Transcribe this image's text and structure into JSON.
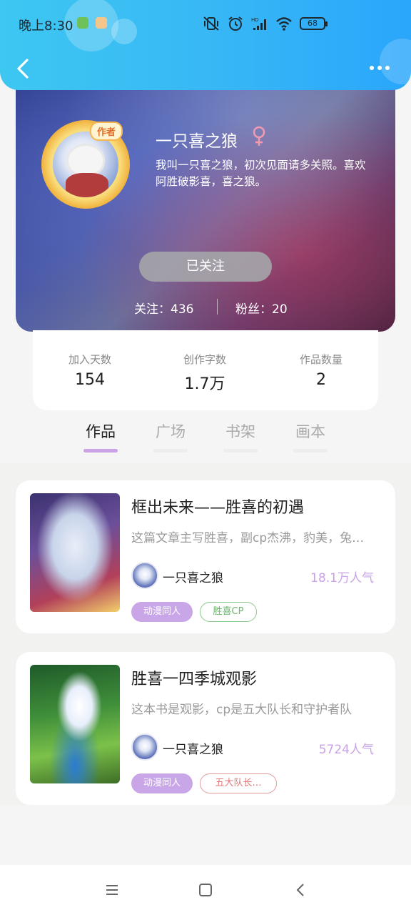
{
  "status_bar": {
    "time": "晚上8:30",
    "battery": "68",
    "icons": [
      "app-icon-green",
      "app-icon-orange",
      "vibrate-off-icon",
      "alarm-icon",
      "signal-hd-icon",
      "wifi-icon"
    ]
  },
  "nav": {
    "back_icon": "back-arrow-icon",
    "more_icon": "more-dots-icon"
  },
  "profile": {
    "author_badge": "作者",
    "username": "一只喜之狼",
    "gender_symbol": "♀",
    "bio": "我叫一只喜之狼，初次见面请多关照。喜欢阿胜破影喜，喜之狼。",
    "follow_button": "已关注",
    "following": "关注：436",
    "fans": "粉丝：20"
  },
  "stats": [
    {
      "label": "加入天数",
      "value": "154"
    },
    {
      "label": "创作字数",
      "value": "1.7万"
    },
    {
      "label": "作品数量",
      "value": "2"
    }
  ],
  "tabs": [
    {
      "label": "作品",
      "active": true
    },
    {
      "label": "广场",
      "active": false
    },
    {
      "label": "书架",
      "active": false
    },
    {
      "label": "画本",
      "active": false
    }
  ],
  "books": [
    {
      "title": "框出未来——胜喜的初遇",
      "description": "这篇文章主写胜喜，副cp杰沸，豹美，兔…",
      "author": "一只喜之狼",
      "popularity": "18.1万人气",
      "tags": [
        "动漫同人",
        "胜喜CP"
      ]
    },
    {
      "title": "胜喜一四季城观影",
      "description": "这本书是观影，cp是五大队长和守护者队",
      "author": "一只喜之狼",
      "popularity": "5724人气",
      "tags": [
        "动漫同人",
        "五大队长…"
      ]
    }
  ],
  "colors": {
    "header_blue": "#38b8f5",
    "accent_purple": "#c9a3e6",
    "tag_green": "#6ab46b",
    "tag_red": "#e07a7a",
    "gender_pink": "#f29ab0"
  },
  "system_nav": [
    "menu-icon",
    "home-square-icon",
    "back-triangle-icon"
  ]
}
